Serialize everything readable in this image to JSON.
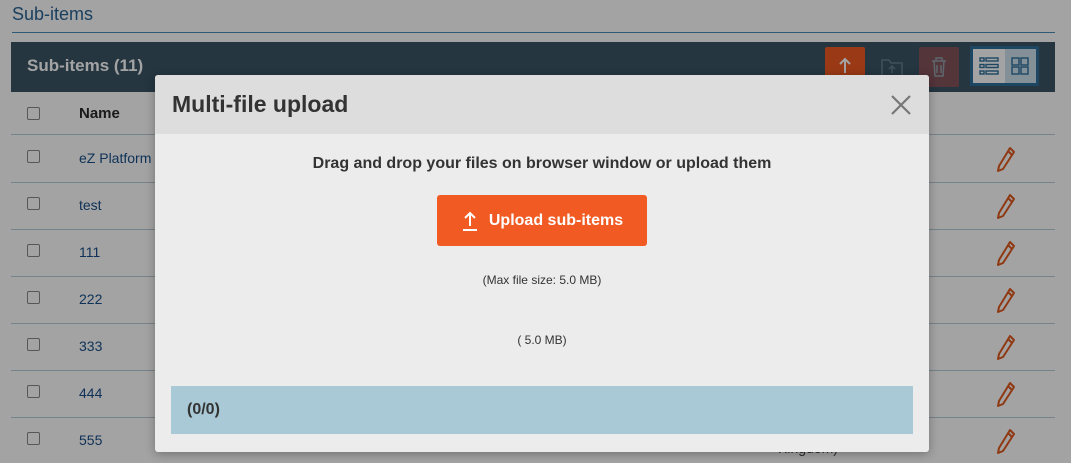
{
  "page": {
    "heading": "Sub-items"
  },
  "panel": {
    "title": "Sub-items (11)",
    "column_name": "Name",
    "rows": [
      {
        "name": "eZ Platform"
      },
      {
        "name": "test"
      },
      {
        "name": "111"
      },
      {
        "name": "222"
      },
      {
        "name": "333"
      },
      {
        "name": "444"
      },
      {
        "name": "555"
      }
    ],
    "trailing_text": "Kingdom)"
  },
  "toolbar": {
    "upload_icon": "upload-icon",
    "move_icon": "move-folder-icon",
    "delete_icon": "trash-icon",
    "list_view_icon": "list-view-icon",
    "grid_view_icon": "grid-view-icon"
  },
  "modal": {
    "title": "Multi-file upload",
    "drag_drop_text": "Drag and drop your files on browser window or upload them",
    "upload_button_label": "Upload sub-items",
    "max_file_size_text": "(Max file size: 5.0 MB)",
    "size_text": "( 5.0 MB)",
    "progress_text": "(0/0)"
  },
  "colors": {
    "accent": "#f15a22",
    "header_bg": "#3a5566",
    "link": "#1a4f8a",
    "progress_bg": "#a9c9d6"
  }
}
